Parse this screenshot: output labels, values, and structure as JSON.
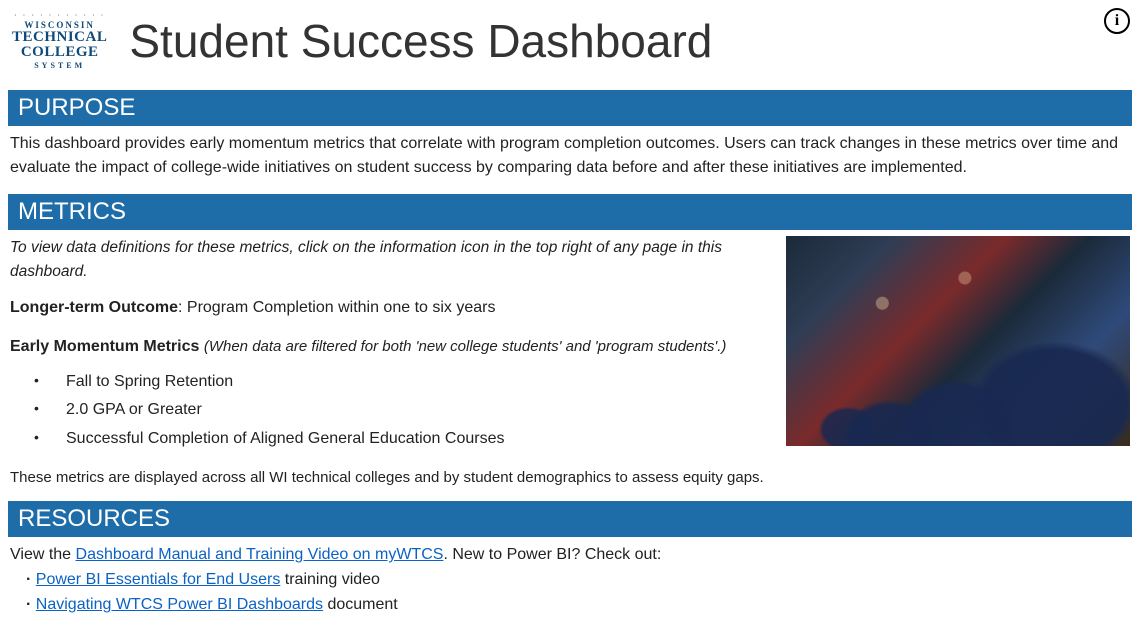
{
  "logo": {
    "line_wisconsin": "WISCONSIN",
    "line_technical": "TECHNICAL",
    "line_college": "COLLEGE",
    "line_system": "SYSTEM"
  },
  "page_title": "Student Success Dashboard",
  "info_icon_label": "i",
  "sections": {
    "purpose": {
      "heading": "PURPOSE",
      "body": "This dashboard provides early momentum metrics that correlate with program completion outcomes. Users can track changes in these metrics over time and evaluate the impact of college-wide initiatives on student success by comparing data before and after these initiatives are implemented."
    },
    "metrics": {
      "heading": "METRICS",
      "hint": "To view data definitions for these metrics, click on the information icon in the top right of any page in this dashboard.",
      "longer_term_label": "Longer-term Outcome",
      "longer_term_value": ": Program Completion within one to six years",
      "emm_label": "Early Momentum Metrics",
      "emm_caveat": "(When data are filtered for both 'new college students' and 'program students'.)",
      "bullets": [
        "Fall to Spring Retention",
        "2.0 GPA or Greater",
        "Successful Completion of Aligned General Education Courses"
      ],
      "footer": "These metrics are displayed across all WI technical colleges and by student demographics to assess equity gaps."
    },
    "resources": {
      "heading": "RESOURCES",
      "intro_prefix": "View the ",
      "manual_link": "Dashboard Manual and Training Video on myWTCS",
      "intro_suffix": ".  New to Power BI? Check out:",
      "links": [
        {
          "text": "Power BI Essentials for End Users",
          "suffix": " training video"
        },
        {
          "text": "Navigating WTCS Power BI Dashboards",
          "suffix": " document"
        }
      ]
    }
  }
}
